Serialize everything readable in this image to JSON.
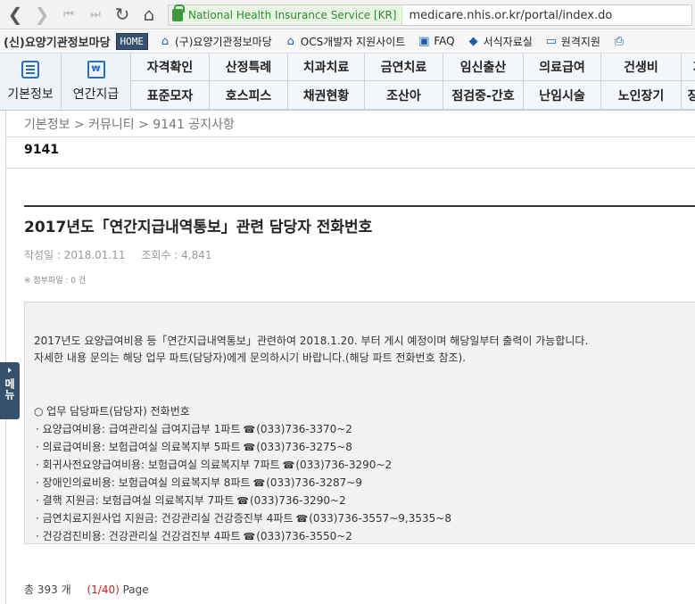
{
  "browser": {
    "security_label": "National Health Insurance Service [KR]",
    "url": "medicare.nhis.or.kr/portal/index.do"
  },
  "bookmarks": {
    "site_name": "(신)요양기관정보마당",
    "home_badge": "HOME",
    "items": [
      {
        "label": "(구)요양기관정보마당",
        "icon": "home-icon"
      },
      {
        "label": "OCS개발자 지원사이트",
        "icon": "home-icon"
      },
      {
        "label": "FAQ",
        "icon": "person-card-icon"
      },
      {
        "label": "서식자료실",
        "icon": "shield-icon"
      },
      {
        "label": "원격지원",
        "icon": "monitor-icon"
      }
    ]
  },
  "topnav": {
    "tab_basic": "기본정보",
    "tab_annual": "연간지급",
    "row1": [
      "자격확인",
      "산정특례",
      "치과치료",
      "금연치료",
      "임신출산",
      "의료급여",
      "건생비",
      "자"
    ],
    "row2": [
      "표준모자",
      "호스피스",
      "채권현황",
      "조산아",
      "점검중-간호",
      "난임시술",
      "노인장기",
      "장애"
    ]
  },
  "page": {
    "breadcrumb": "기본정보 > 커뮤니티 > 9141 공지사항",
    "board_title": "9141",
    "post_title": "2017년도「연간지급내역통보」관련 담당자 전화번호",
    "date_label": "작성일 : 2018.01.11",
    "views_label": "조회수 : 4,841",
    "attachment_label": "※ 첨부파일 : 0 건",
    "body_line1": "2017년도 요양급여비용 등「연간지급내역통보」관련하여 2018.1.20. 부터 게시 예정이며 해당일부터 출력이 가능합니다.",
    "body_line2": "자세한 내용 문의는 해당 업무 파트(담당자)에게 문의하시기 바랍니다.(해당 파트 전화번호 참조).",
    "contact_heading": "○ 업무 담당파트(담당자) 전화번호",
    "contacts": [
      {
        "label": "요양급여비용: 급여관리실 급여지급부 1파트",
        "phone": "(033)736-3370~2"
      },
      {
        "label": "의료급여비용: 보험급여실 의료복지부 5파트",
        "phone": "(033)736-3275~8"
      },
      {
        "label": "회귀사전요양급여비용: 보험급여실 의료복지부 7파트",
        "phone": "(033)736-3290~2"
      },
      {
        "label": "장애인의료비용: 보험급여실 의료복지부 8파트",
        "phone": "(033)736-3287~9"
      },
      {
        "label": "결핵 지원금: 보험급여실 의료복지부 7파트",
        "phone": "(033)736-3290~2"
      },
      {
        "label": "금연치료지원사업 지원금: 건강관리실 건강증진부 4파트",
        "phone": "(033)736-3557~9,3535~8"
      },
      {
        "label": "건강검진비용: 건강관리실 건강검진부 4파트",
        "phone": "(033)736-3550~2"
      }
    ],
    "phone_symbol": "☎",
    "total_label": "총 393 개",
    "page_indicator": "(1/40)",
    "page_suffix": "Page"
  },
  "side_menu": {
    "label": "메뉴"
  }
}
